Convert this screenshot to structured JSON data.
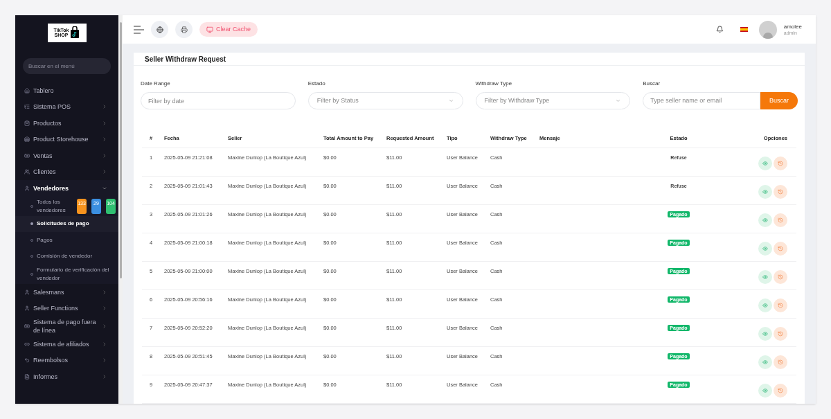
{
  "sidebar": {
    "logo": {
      "line1": "TikTok",
      "line2": "SHOP"
    },
    "search": {
      "placeholder": "Buscar en el menú"
    },
    "items": [
      {
        "label": "Tablero",
        "has_arrow": false,
        "expanded": false
      },
      {
        "label": "Sistema POS",
        "has_arrow": true,
        "expanded": false
      },
      {
        "label": "Productos",
        "has_arrow": true,
        "expanded": false
      },
      {
        "label": "Product Storehouse",
        "has_arrow": true,
        "expanded": false
      },
      {
        "label": "Ventas",
        "has_arrow": true,
        "expanded": false
      },
      {
        "label": "Clientes",
        "has_arrow": true,
        "expanded": false
      },
      {
        "label": "Vendedores",
        "has_arrow": true,
        "expanded": true,
        "children": [
          {
            "label": "Todos los vendedores",
            "selected": false,
            "badges": [
              {
                "text": "133",
                "color": "#f7931e"
              },
              {
                "text": "29",
                "color": "#3b8fe0"
              },
              {
                "text": "104",
                "color": "#2fbf71"
              }
            ]
          },
          {
            "label": "Solicitudes de pago",
            "selected": true
          },
          {
            "label": "Pagos",
            "selected": false
          },
          {
            "label": "Comisión de vendedor",
            "selected": false
          },
          {
            "label": "Formulario de verificación del vendedor",
            "selected": false
          }
        ]
      },
      {
        "label": "Salesmans",
        "has_arrow": true,
        "expanded": false
      },
      {
        "label": "Seller Functions",
        "has_arrow": true,
        "expanded": false
      },
      {
        "label": "Sistema de pago fuera de línea",
        "has_arrow": true,
        "expanded": false
      },
      {
        "label": "Sistema de afiliados",
        "has_arrow": true,
        "expanded": false
      },
      {
        "label": "Reembolsos",
        "has_arrow": true,
        "expanded": false
      },
      {
        "label": "Informes",
        "has_arrow": true,
        "expanded": false
      }
    ]
  },
  "topbar": {
    "clear_cache": "Clear Cache",
    "user": {
      "name": "amolee",
      "role": "admin"
    }
  },
  "card": {
    "title": "Seller Withdraw Request",
    "filters": [
      {
        "label": "Date Range",
        "placeholder": "Filter by date",
        "kind": "text"
      },
      {
        "label": "Estado",
        "placeholder": "Filter by Status",
        "kind": "select"
      },
      {
        "label": "Withdraw Type",
        "placeholder": "Filter by Withdraw Type",
        "kind": "select"
      },
      {
        "label": "Buscar",
        "placeholder": "Type seller name or email",
        "kind": "search",
        "button": "Buscar"
      }
    ],
    "table": {
      "columns": [
        "#",
        "Fecha",
        "Seller",
        "Total Amount to Pay",
        "Requested Amount",
        "Tipo",
        "Withdraw Type",
        "Mensaje",
        "Estado",
        "Opciones"
      ],
      "rows": [
        {
          "num": "1",
          "fecha": "2025-05-09 21:21:08",
          "seller": "Maxine Dunlop (La Boutique Azul)",
          "total": "$0.00",
          "requested": "$11.00",
          "tipo": "User Balance",
          "withdraw_type": "Cash",
          "estado": {
            "text": "Refuse",
            "kind": "plain"
          }
        },
        {
          "num": "2",
          "fecha": "2025-05-09 21:01:43",
          "seller": "Maxine Dunlop (La Boutique Azul)",
          "total": "$0.00",
          "requested": "$11.00",
          "tipo": "User Balance",
          "withdraw_type": "Cash",
          "estado": {
            "text": "Refuse",
            "kind": "plain"
          }
        },
        {
          "num": "3",
          "fecha": "2025-05-09 21:01:26",
          "seller": "Maxine Dunlop (La Boutique Azul)",
          "total": "$0.00",
          "requested": "$11.00",
          "tipo": "User Balance",
          "withdraw_type": "Cash",
          "estado": {
            "text": "Pagado",
            "kind": "badge"
          }
        },
        {
          "num": "4",
          "fecha": "2025-05-09 21:00:18",
          "seller": "Maxine Dunlop (La Boutique Azul)",
          "total": "$0.00",
          "requested": "$11.00",
          "tipo": "User Balance",
          "withdraw_type": "Cash",
          "estado": {
            "text": "Pagado",
            "kind": "badge"
          }
        },
        {
          "num": "5",
          "fecha": "2025-05-09 21:00:00",
          "seller": "Maxine Dunlop (La Boutique Azul)",
          "total": "$0.00",
          "requested": "$11.00",
          "tipo": "User Balance",
          "withdraw_type": "Cash",
          "estado": {
            "text": "Pagado",
            "kind": "badge"
          }
        },
        {
          "num": "6",
          "fecha": "2025-05-09 20:56:16",
          "seller": "Maxine Dunlop (La Boutique Azul)",
          "total": "$0.00",
          "requested": "$11.00",
          "tipo": "User Balance",
          "withdraw_type": "Cash",
          "estado": {
            "text": "Pagado",
            "kind": "badge"
          }
        },
        {
          "num": "7",
          "fecha": "2025-05-09 20:52:20",
          "seller": "Maxine Dunlop (La Boutique Azul)",
          "total": "$0.00",
          "requested": "$11.00",
          "tipo": "User Balance",
          "withdraw_type": "Cash",
          "estado": {
            "text": "Pagado",
            "kind": "badge"
          }
        },
        {
          "num": "8",
          "fecha": "2025-05-09 20:51:45",
          "seller": "Maxine Dunlop (La Boutique Azul)",
          "total": "$0.00",
          "requested": "$11.00",
          "tipo": "User Balance",
          "withdraw_type": "Cash",
          "estado": {
            "text": "Pagado",
            "kind": "badge"
          }
        },
        {
          "num": "9",
          "fecha": "2025-05-09 20:47:37",
          "seller": "Maxine Dunlop (La Boutique Azul)",
          "total": "$0.00",
          "requested": "$11.00",
          "tipo": "User Balance",
          "withdraw_type": "Cash",
          "estado": {
            "text": "Pagado",
            "kind": "badge"
          }
        }
      ]
    }
  }
}
